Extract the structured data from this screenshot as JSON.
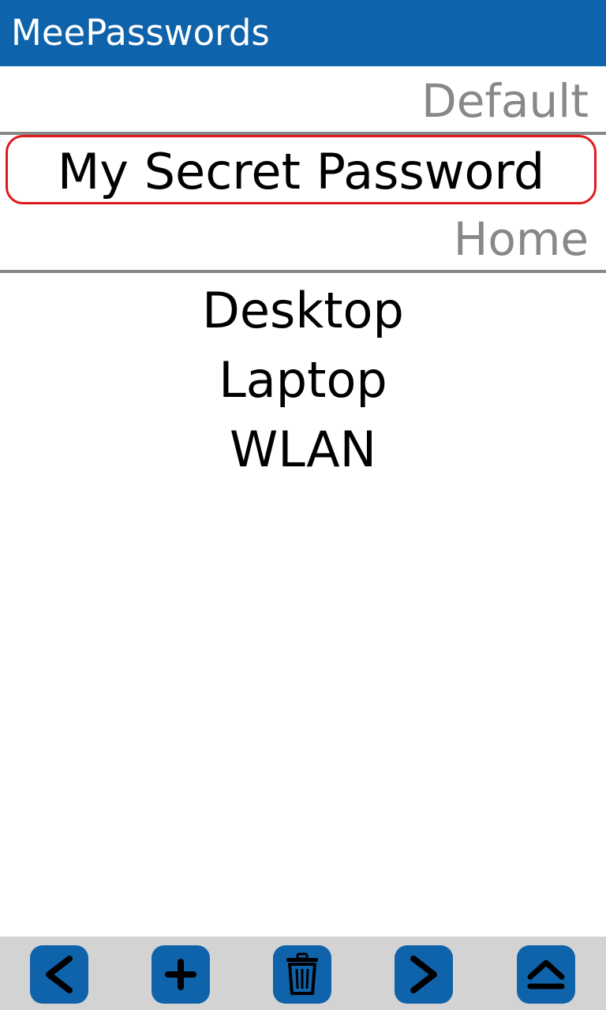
{
  "app": {
    "title": "MeePasswords"
  },
  "groups": [
    {
      "name": "Default",
      "items": [
        "My Secret Password"
      ]
    },
    {
      "name": "Home",
      "items": [
        "Desktop",
        "Laptop",
        "WLAN"
      ]
    }
  ],
  "selected_item": "My Secret Password",
  "toolbar": {
    "buttons": [
      {
        "icon": "chevron-left-icon"
      },
      {
        "icon": "plus-icon"
      },
      {
        "icon": "trash-icon"
      },
      {
        "icon": "chevron-right-icon"
      },
      {
        "icon": "eject-icon"
      }
    ]
  },
  "colors": {
    "accent": "#0e63ab",
    "group_label": "#888888",
    "selection_border": "#e0191d",
    "toolbar_bg": "#d3d3d3"
  }
}
